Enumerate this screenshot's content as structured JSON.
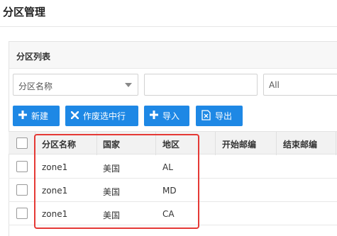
{
  "page": {
    "title": "分区管理"
  },
  "panel": {
    "title": "分区列表"
  },
  "filters": {
    "name_select": {
      "value": "分区名称"
    },
    "region_select": {
      "value": "All"
    }
  },
  "toolbar": {
    "new_label": "新建",
    "void_label": "作废选中行",
    "import_label": "导入",
    "export_label": "导出"
  },
  "table": {
    "columns": [
      "分区名称",
      "国家",
      "地区",
      "开始邮编",
      "结束邮编"
    ],
    "rows": [
      {
        "name": "zone1",
        "country": "美国",
        "region": "AL"
      },
      {
        "name": "zone1",
        "country": "美国",
        "region": "MD"
      },
      {
        "name": "zone1",
        "country": "美国",
        "region": "CA"
      }
    ]
  },
  "colors": {
    "accent": "#1e88e5",
    "highlight": "#e53935"
  }
}
